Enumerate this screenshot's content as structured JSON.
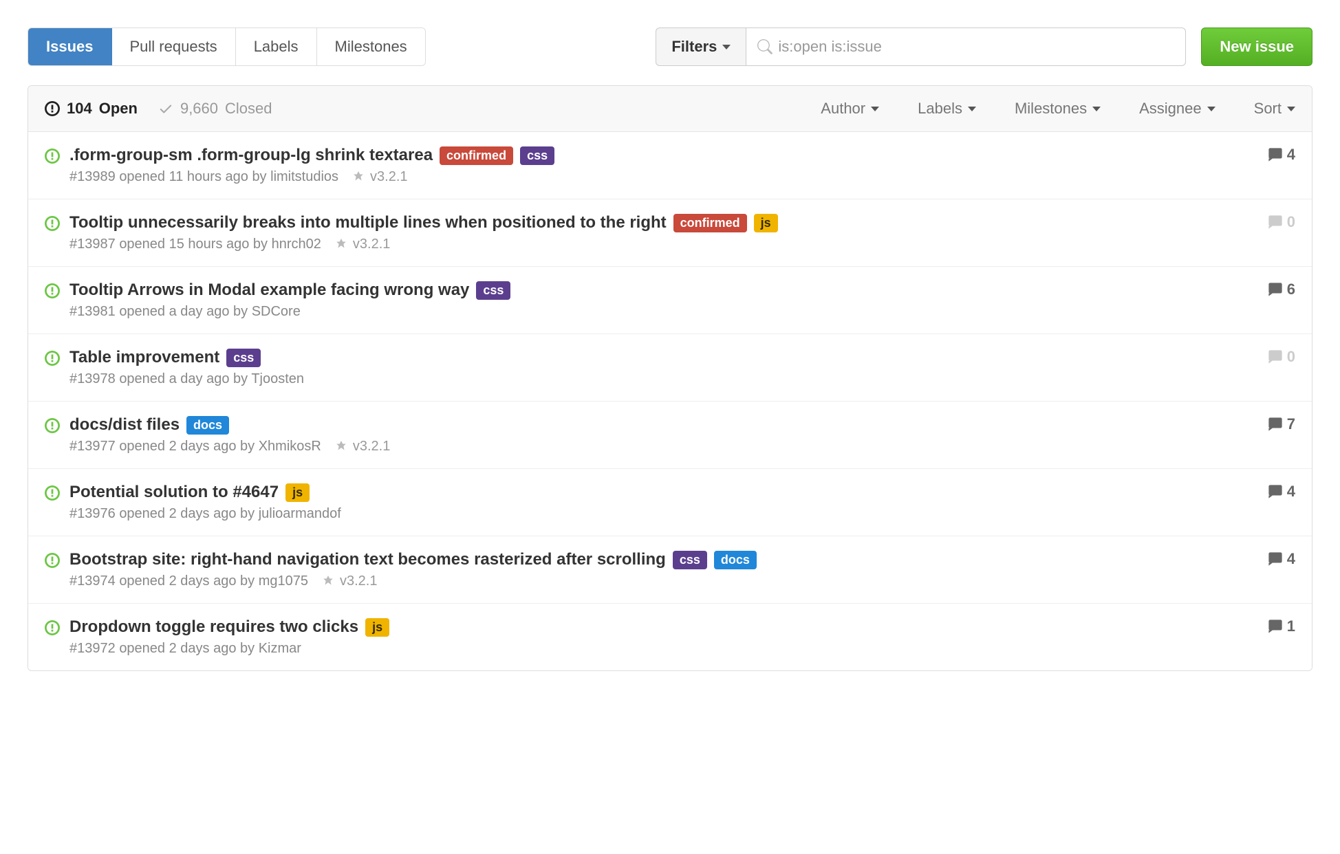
{
  "nav": {
    "issues": "Issues",
    "pulls": "Pull requests",
    "labels": "Labels",
    "milestones": "Milestones"
  },
  "filters": {
    "label": "Filters"
  },
  "search": {
    "placeholder": "is:open is:issue"
  },
  "new_issue": "New issue",
  "toolbar": {
    "open_count": "104",
    "open_label": "Open",
    "closed_count": "9,660",
    "closed_label": "Closed",
    "author": "Author",
    "labels": "Labels",
    "milestones": "Milestones",
    "assignee": "Assignee",
    "sort": "Sort"
  },
  "label_colors": {
    "confirmed": "#c9493a",
    "css": "#5b3f8e",
    "js": "#f0b400",
    "docs": "#2087d9"
  },
  "label_text_colors": {
    "confirmed": "#fff",
    "css": "#fff",
    "js": "#332b00",
    "docs": "#fff"
  },
  "issues": [
    {
      "title": ".form-group-sm .form-group-lg shrink textarea",
      "labels": [
        "confirmed",
        "css"
      ],
      "number": "#13989",
      "opened": "opened 11 hours ago by",
      "author": "limitstudios",
      "milestone": "v3.2.1",
      "comments": 4
    },
    {
      "title": "Tooltip unnecessarily breaks into multiple lines when positioned to the right",
      "labels": [
        "confirmed",
        "js"
      ],
      "number": "#13987",
      "opened": "opened 15 hours ago by",
      "author": "hnrch02",
      "milestone": "v3.2.1",
      "comments": 0
    },
    {
      "title": "Tooltip Arrows in Modal example facing wrong way",
      "labels": [
        "css"
      ],
      "number": "#13981",
      "opened": "opened a day ago by",
      "author": "SDCore",
      "milestone": "",
      "comments": 6
    },
    {
      "title": "Table improvement",
      "labels": [
        "css"
      ],
      "number": "#13978",
      "opened": "opened a day ago by",
      "author": "Tjoosten",
      "milestone": "",
      "comments": 0
    },
    {
      "title": "docs/dist files",
      "labels": [
        "docs"
      ],
      "number": "#13977",
      "opened": "opened 2 days ago by",
      "author": "XhmikosR",
      "milestone": "v3.2.1",
      "comments": 7
    },
    {
      "title": "Potential solution to #4647",
      "labels": [
        "js"
      ],
      "number": "#13976",
      "opened": "opened 2 days ago by",
      "author": "julioarmandof",
      "milestone": "",
      "comments": 4
    },
    {
      "title": "Bootstrap site: right-hand navigation text becomes rasterized after scrolling",
      "labels": [
        "css",
        "docs"
      ],
      "number": "#13974",
      "opened": "opened 2 days ago by",
      "author": "mg1075",
      "milestone": "v3.2.1",
      "comments": 4
    },
    {
      "title": "Dropdown toggle requires two clicks",
      "labels": [
        "js"
      ],
      "number": "#13972",
      "opened": "opened 2 days ago by",
      "author": "Kizmar",
      "milestone": "",
      "comments": 1
    }
  ]
}
